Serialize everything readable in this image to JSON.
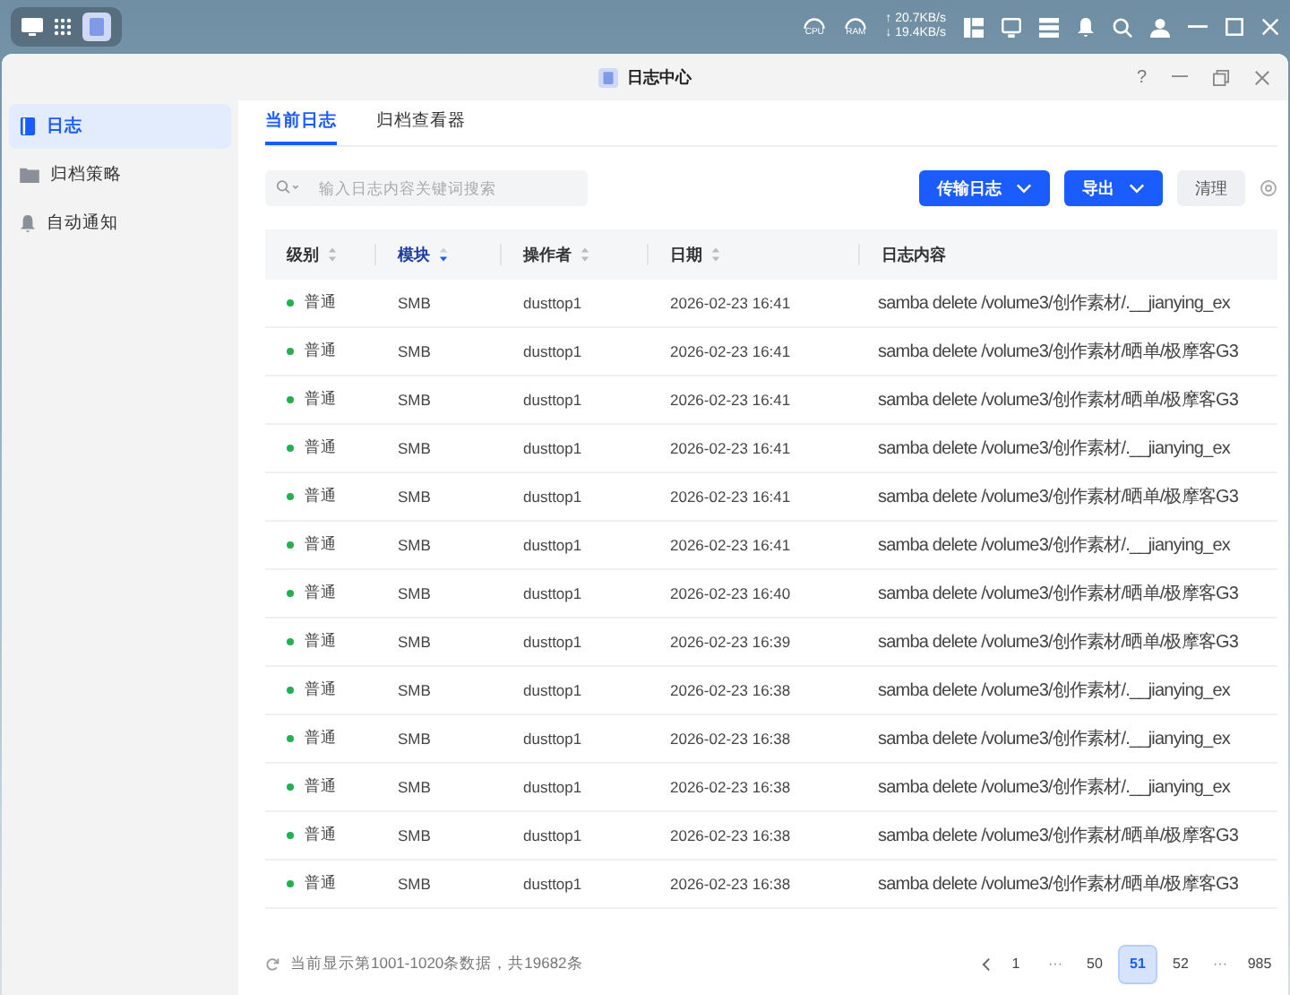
{
  "taskbar": {
    "cpu_label": "CPU",
    "ram_label": "RAM",
    "upload": "↑ 20.7KB/s",
    "download": "↓ 19.4KB/s"
  },
  "window": {
    "title": "日志中心",
    "help": "?"
  },
  "sidebar": {
    "items": [
      {
        "label": "日志",
        "selected": true,
        "kind": "log"
      },
      {
        "label": "归档策略",
        "selected": false,
        "kind": "folder"
      },
      {
        "label": "自动通知",
        "selected": false,
        "kind": "bell"
      }
    ]
  },
  "tabs": [
    {
      "label": "当前日志",
      "selected": true
    },
    {
      "label": "归档查看器",
      "selected": false
    }
  ],
  "search": {
    "placeholder": "输入日志内容关键词搜索"
  },
  "buttons": [
    {
      "label": "传输日志",
      "kind": "dropdown"
    },
    {
      "label": "导出",
      "kind": "dropdown"
    },
    {
      "label": "清理",
      "kind": "plain"
    }
  ],
  "table": {
    "columns": [
      {
        "label": "级别",
        "sortable": true,
        "sorted": false
      },
      {
        "label": "模块",
        "sortable": true,
        "sorted": true
      },
      {
        "label": "操作者",
        "sortable": true,
        "sorted": false
      },
      {
        "label": "日期",
        "sortable": true,
        "sorted": false
      },
      {
        "label": "日志内容",
        "sortable": false
      }
    ],
    "rows": [
      {
        "level": "普通",
        "color": "#22b14c",
        "module": "SMB",
        "operator": "dusttop1",
        "date": "2026-02-23 16:41",
        "content": "samba delete /volume3/创作素材/.__jianying_ex"
      },
      {
        "level": "普通",
        "color": "#22b14c",
        "module": "SMB",
        "operator": "dusttop1",
        "date": "2026-02-23 16:41",
        "content": "samba delete /volume3/创作素材/晒单/极摩客G3"
      },
      {
        "level": "普通",
        "color": "#22b14c",
        "module": "SMB",
        "operator": "dusttop1",
        "date": "2026-02-23 16:41",
        "content": "samba delete /volume3/创作素材/晒单/极摩客G3"
      },
      {
        "level": "普通",
        "color": "#22b14c",
        "module": "SMB",
        "operator": "dusttop1",
        "date": "2026-02-23 16:41",
        "content": "samba delete /volume3/创作素材/.__jianying_ex"
      },
      {
        "level": "普通",
        "color": "#22b14c",
        "module": "SMB",
        "operator": "dusttop1",
        "date": "2026-02-23 16:41",
        "content": "samba delete /volume3/创作素材/晒单/极摩客G3"
      },
      {
        "level": "普通",
        "color": "#22b14c",
        "module": "SMB",
        "operator": "dusttop1",
        "date": "2026-02-23 16:41",
        "content": "samba delete /volume3/创作素材/.__jianying_ex"
      },
      {
        "level": "普通",
        "color": "#22b14c",
        "module": "SMB",
        "operator": "dusttop1",
        "date": "2026-02-23 16:40",
        "content": "samba delete /volume3/创作素材/晒单/极摩客G3"
      },
      {
        "level": "普通",
        "color": "#22b14c",
        "module": "SMB",
        "operator": "dusttop1",
        "date": "2026-02-23 16:39",
        "content": "samba delete /volume3/创作素材/晒单/极摩客G3"
      },
      {
        "level": "普通",
        "color": "#22b14c",
        "module": "SMB",
        "operator": "dusttop1",
        "date": "2026-02-23 16:38",
        "content": "samba delete /volume3/创作素材/.__jianying_ex"
      },
      {
        "level": "普通",
        "color": "#22b14c",
        "module": "SMB",
        "operator": "dusttop1",
        "date": "2026-02-23 16:38",
        "content": "samba delete /volume3/创作素材/.__jianying_ex"
      },
      {
        "level": "普通",
        "color": "#22b14c",
        "module": "SMB",
        "operator": "dusttop1",
        "date": "2026-02-23 16:38",
        "content": "samba delete /volume3/创作素材/.__jianying_ex"
      },
      {
        "level": "普通",
        "color": "#22b14c",
        "module": "SMB",
        "operator": "dusttop1",
        "date": "2026-02-23 16:38",
        "content": "samba delete /volume3/创作素材/晒单/极摩客G3"
      },
      {
        "level": "普通",
        "color": "#22b14c",
        "module": "SMB",
        "operator": "dusttop1",
        "date": "2026-02-23 16:38",
        "content": "samba delete /volume3/创作素材/晒单/极摩客G3"
      }
    ]
  },
  "footer": {
    "summary": "当前显示第1001-1020条数据，共19682条"
  },
  "pagination": [
    {
      "label": "1",
      "kind": "page",
      "selected": false
    },
    {
      "label": "···",
      "kind": "ellipsis"
    },
    {
      "label": "50",
      "kind": "page",
      "selected": false
    },
    {
      "label": "51",
      "kind": "page",
      "selected": true
    },
    {
      "label": "52",
      "kind": "page",
      "selected": false
    },
    {
      "label": "···",
      "kind": "ellipsis"
    },
    {
      "label": "985",
      "kind": "page",
      "selected": false
    }
  ]
}
